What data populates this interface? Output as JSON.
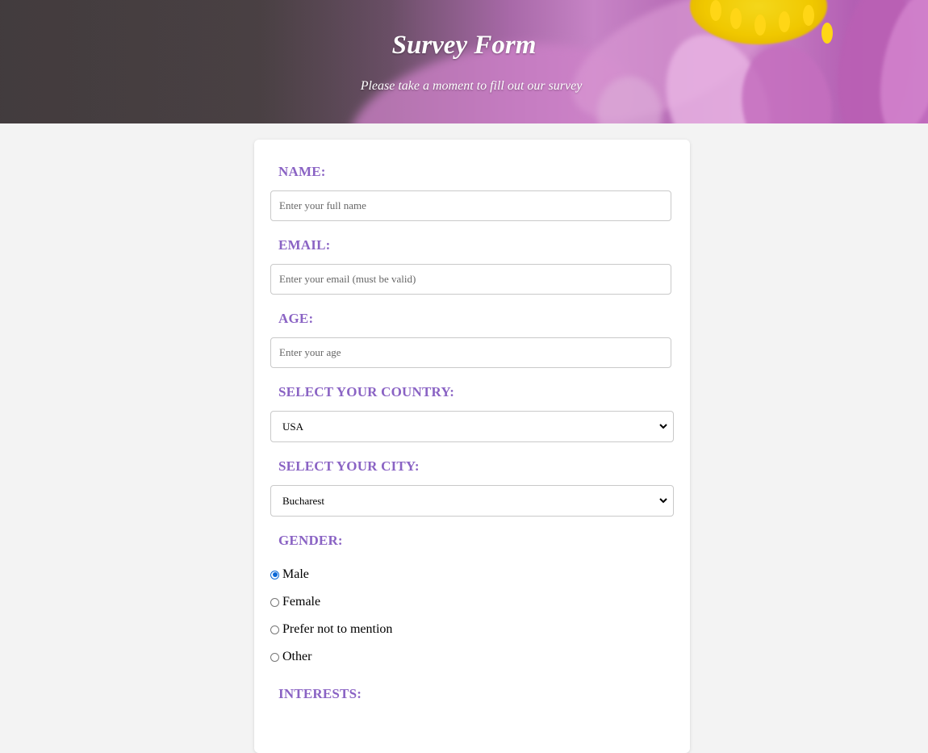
{
  "header": {
    "title": "Survey Form",
    "subtitle": "Please take a moment to fill out our survey"
  },
  "form": {
    "name": {
      "label": "NAME:",
      "placeholder": "Enter your full name",
      "value": ""
    },
    "email": {
      "label": "EMAIL:",
      "placeholder": "Enter your email (must be valid)",
      "value": ""
    },
    "age": {
      "label": "AGE:",
      "placeholder": "Enter your age",
      "value": ""
    },
    "country": {
      "label": "SELECT YOUR COUNTRY:",
      "selected": "USA"
    },
    "city": {
      "label": "SELECT YOUR CITY:",
      "selected": "Bucharest"
    },
    "gender": {
      "label": "GENDER:",
      "options": [
        {
          "label": "Male",
          "checked": true
        },
        {
          "label": "Female",
          "checked": false
        },
        {
          "label": "Prefer not to mention",
          "checked": false
        },
        {
          "label": "Other",
          "checked": false
        }
      ]
    },
    "interests": {
      "label": "INTERESTS:"
    }
  },
  "colors": {
    "label": "#8a63c4",
    "page_background": "#f3f3f3",
    "radio_accent": "#0b67d6"
  },
  "icons": {
    "select_arrow": "chevron-down-icon"
  }
}
